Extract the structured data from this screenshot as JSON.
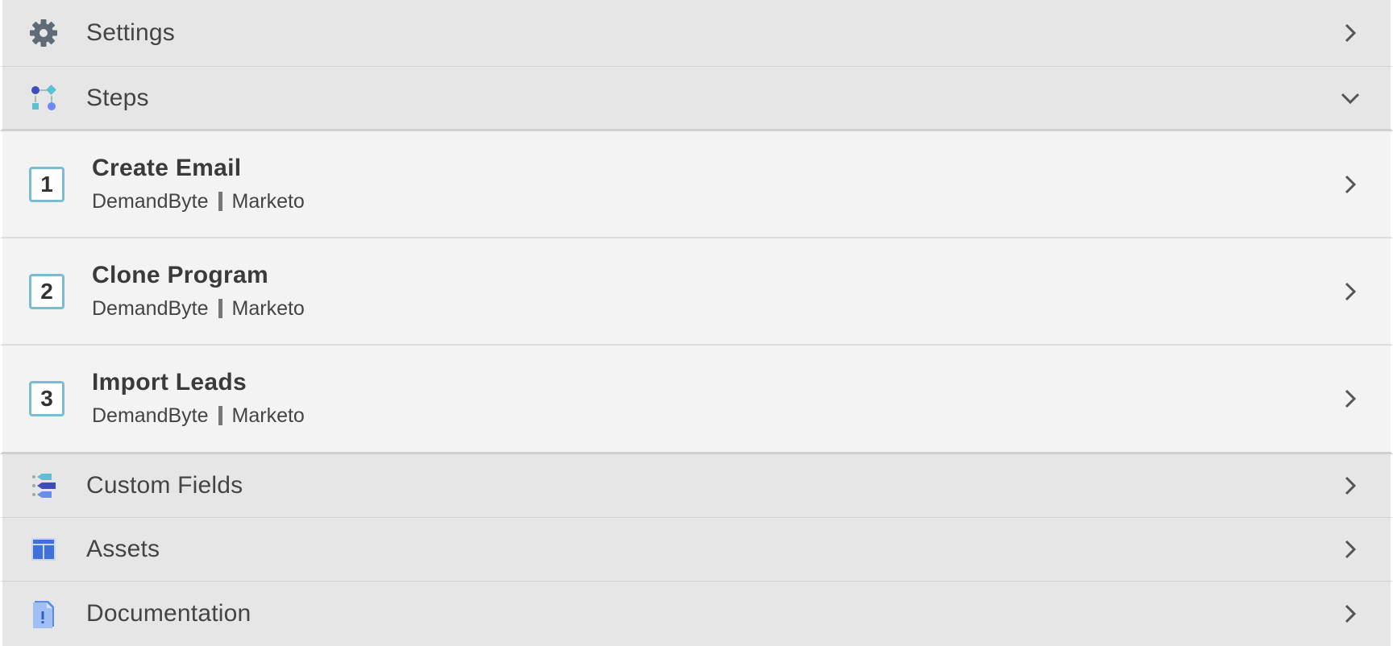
{
  "sections": {
    "settings": {
      "label": "Settings",
      "icon": "gear-icon"
    },
    "steps": {
      "label": "Steps",
      "icon": "workflow-icon"
    },
    "custom_fields": {
      "label": "Custom Fields",
      "icon": "custom-fields-icon"
    },
    "assets": {
      "label": "Assets",
      "icon": "layout-icon"
    },
    "documentation": {
      "label": "Documentation",
      "icon": "document-icon"
    }
  },
  "steps": [
    {
      "number": "1",
      "title": "Create Email",
      "app": "DemandByte",
      "target": "Marketo"
    },
    {
      "number": "2",
      "title": "Clone Program",
      "app": "DemandByte",
      "target": "Marketo"
    },
    {
      "number": "3",
      "title": "Import Leads",
      "app": "DemandByte",
      "target": "Marketo"
    }
  ],
  "colors": {
    "header_bg": "#e6e6e6",
    "step_bg": "#f3f3f3",
    "step_border": "#7bbcd2",
    "chevron": "#555555"
  }
}
